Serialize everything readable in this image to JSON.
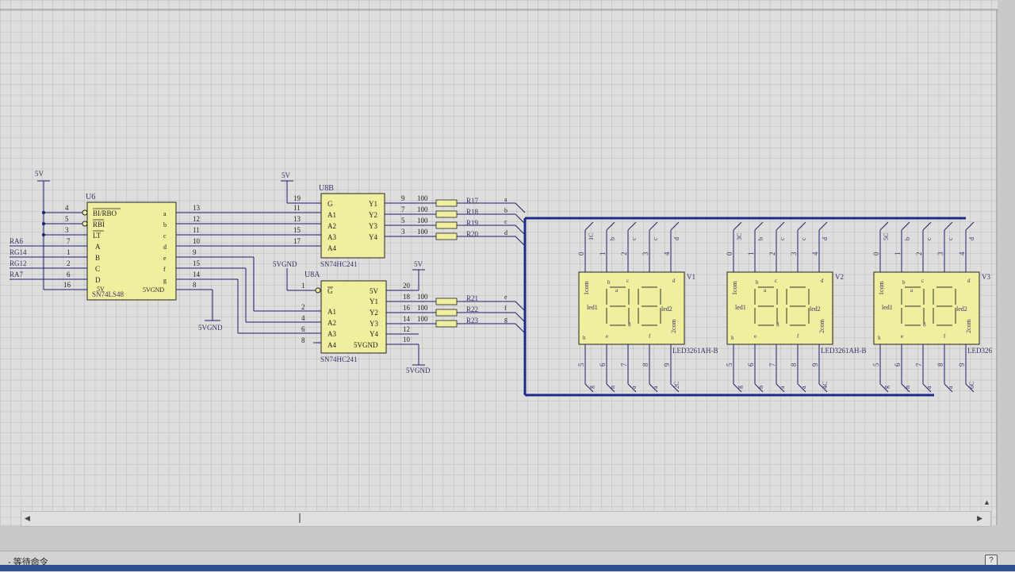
{
  "status": {
    "text": "- 等待命令",
    "help_icon": "question-icon"
  },
  "colors": {
    "grid": "#9a9a9a",
    "chip_fill": "#efef9e",
    "wire": "#1c1e6e",
    "bus": "#1b2a8c",
    "text": "#3a2f6a"
  },
  "chips": {
    "u6": {
      "ref": "U6",
      "part": "SN74LS48",
      "inputs": [
        {
          "pin": "4",
          "label": "BI/RBO"
        },
        {
          "pin": "5",
          "label": "RBI"
        },
        {
          "pin": "3",
          "label": "LT"
        },
        {
          "pin": "7",
          "label": "A"
        },
        {
          "pin": "1",
          "label": "B"
        },
        {
          "pin": "2",
          "label": "C"
        },
        {
          "pin": "6",
          "label": "D"
        },
        {
          "pin": "16",
          "label": "5V"
        }
      ],
      "outputs": [
        {
          "pin": "13",
          "label": "a"
        },
        {
          "pin": "12",
          "label": "b"
        },
        {
          "pin": "11",
          "label": "c"
        },
        {
          "pin": "10",
          "label": "d"
        },
        {
          "pin": "9",
          "label": "e"
        },
        {
          "pin": "15",
          "label": "f"
        },
        {
          "pin": "14",
          "label": "g"
        },
        {
          "pin": "8",
          "label": "5VGND"
        }
      ]
    },
    "u8b": {
      "ref": "U8B",
      "part": "SN74HC241",
      "inputs": [
        {
          "pin": "19",
          "label": "G"
        },
        {
          "pin": "11",
          "label": "A1"
        },
        {
          "pin": "13",
          "label": "A2"
        },
        {
          "pin": "15",
          "label": "A3"
        },
        {
          "pin": "17",
          "label": "A4"
        }
      ],
      "outputs": [
        {
          "pin": "9",
          "label": "Y1"
        },
        {
          "pin": "7",
          "label": "Y2"
        },
        {
          "pin": "5",
          "label": "Y3"
        },
        {
          "pin": "3",
          "label": "Y4"
        }
      ]
    },
    "u8a": {
      "ref": "U8A",
      "part": "SN74HC241",
      "inputs": [
        {
          "pin": "1",
          "label": "G"
        },
        {
          "pin": "2",
          "label": "A1"
        },
        {
          "pin": "4",
          "label": "A2"
        },
        {
          "pin": "6",
          "label": "A3"
        },
        {
          "pin": "8",
          "label": "A4"
        }
      ],
      "outputs": [
        {
          "pin": "20",
          "label": "5V"
        },
        {
          "pin": "18",
          "label": "Y1"
        },
        {
          "pin": "16",
          "label": "Y2"
        },
        {
          "pin": "14",
          "label": "Y3"
        },
        {
          "pin": "12",
          "label": "Y4"
        },
        {
          "pin": "10",
          "label": "5VGND"
        }
      ]
    }
  },
  "power_labels": {
    "vcc": "5V",
    "gnd": "5VGND"
  },
  "input_nets": [
    "RA6",
    "RG14",
    "RG12",
    "RA7"
  ],
  "resistors": [
    {
      "ref": "R17",
      "value": "100",
      "net": "a"
    },
    {
      "ref": "R18",
      "value": "100",
      "net": "b"
    },
    {
      "ref": "R19",
      "value": "100",
      "net": "c"
    },
    {
      "ref": "R20",
      "value": "100",
      "net": "d"
    },
    {
      "ref": "R21",
      "value": "100",
      "net": "e"
    },
    {
      "ref": "R22",
      "value": "100",
      "net": "f"
    },
    {
      "ref": "R23",
      "value": "100",
      "net": "g"
    }
  ],
  "displays": [
    {
      "ref": "V1",
      "part": "LED3261AH-B",
      "top_pins": [
        "0",
        "1",
        "2",
        "3",
        "4"
      ],
      "top_labels": [
        "1C",
        "b",
        "c",
        "c",
        "d"
      ],
      "bottom_pins": [
        "5",
        "6",
        "7",
        "8",
        "9"
      ],
      "bottom_labels": [
        "g",
        "h",
        "a",
        "a",
        "2C"
      ]
    },
    {
      "ref": "V2",
      "part": "LED3261AH-B",
      "top_pins": [
        "0",
        "1",
        "2",
        "3",
        "4"
      ],
      "top_labels": [
        "3C",
        "b",
        "c",
        "c",
        "d"
      ],
      "bottom_pins": [
        "5",
        "6",
        "7",
        "8",
        "9"
      ],
      "bottom_labels": [
        "g",
        "h",
        "a",
        "a",
        "4C"
      ]
    },
    {
      "ref": "V3",
      "part": "LED326",
      "top_pins": [
        "0",
        "1",
        "2",
        "3",
        "4"
      ],
      "top_labels": [
        "5C",
        "b",
        "c",
        "c",
        "d"
      ],
      "bottom_pins": [
        "5",
        "6",
        "7",
        "8",
        "9"
      ],
      "bottom_labels": [
        "g",
        "h",
        "a",
        "a",
        "6C"
      ]
    }
  ],
  "display_inner": {
    "com1": "1com",
    "com2": "2com",
    "led1": "led1",
    "led2": "led2",
    "seg_top": [
      "b",
      "a",
      "c",
      "d"
    ],
    "seg_bottom": [
      "h",
      "e",
      "f",
      "g"
    ]
  }
}
